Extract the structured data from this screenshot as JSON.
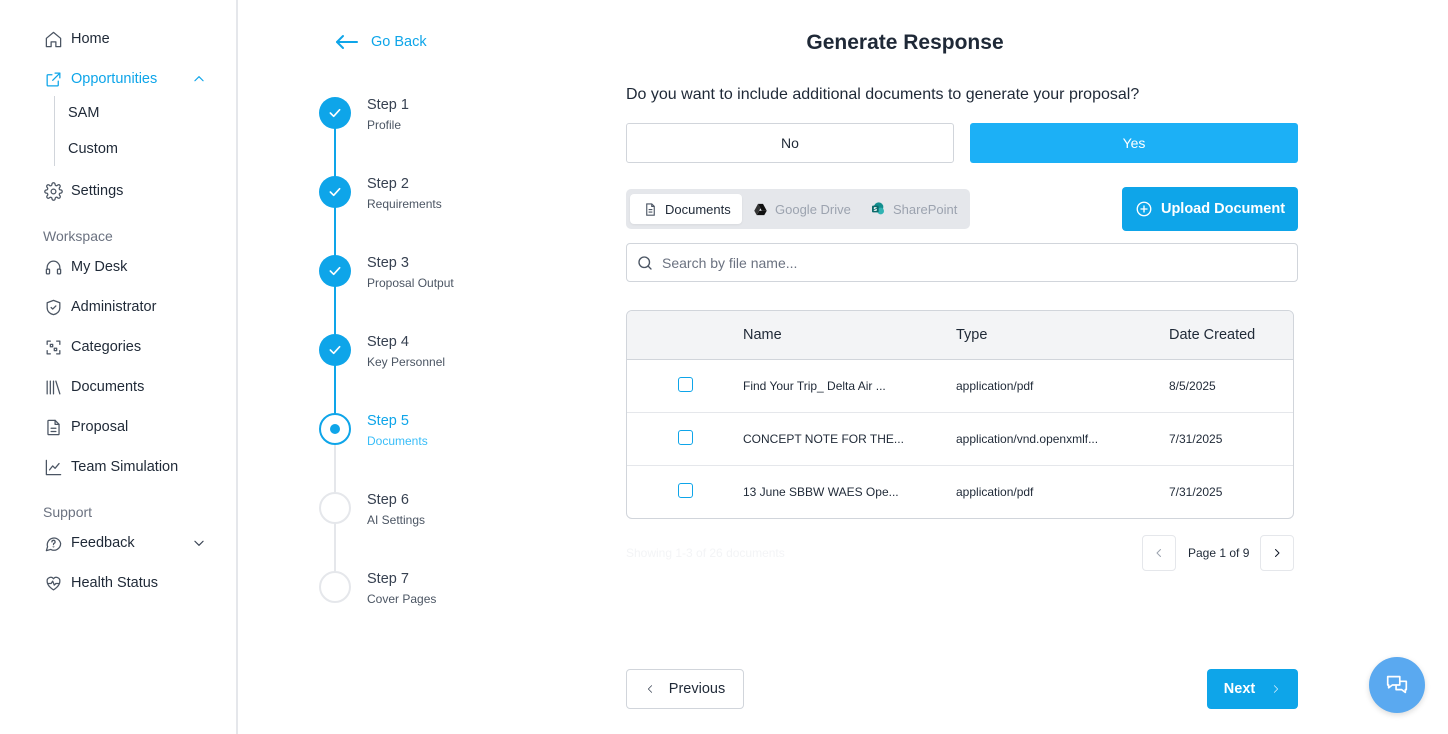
{
  "sidebar": {
    "items": [
      {
        "label": "Home",
        "icon": "home-icon"
      },
      {
        "label": "Opportunities",
        "icon": "external-link-icon",
        "active": true
      },
      {
        "label": "Settings",
        "icon": "gear-icon"
      }
    ],
    "opportunities_sub": [
      "SAM",
      "Custom"
    ],
    "workspace_label": "Workspace",
    "workspace_items": [
      {
        "label": "My Desk",
        "icon": "headset-icon"
      },
      {
        "label": "Administrator",
        "icon": "shield-icon"
      },
      {
        "label": "Categories",
        "icon": "categories-icon"
      },
      {
        "label": "Documents",
        "icon": "library-icon"
      },
      {
        "label": "Proposal",
        "icon": "file-text-icon"
      },
      {
        "label": "Team Simulation",
        "icon": "line-chart-icon"
      }
    ],
    "support_label": "Support",
    "support_items": [
      {
        "label": "Feedback",
        "icon": "message-circle-icon"
      },
      {
        "label": "Health Status",
        "icon": "heart-pulse-icon"
      }
    ]
  },
  "go_back": "Go Back",
  "steps": [
    {
      "title": "Step 1",
      "subtitle": "Profile",
      "status": "done"
    },
    {
      "title": "Step 2",
      "subtitle": "Requirements",
      "status": "done"
    },
    {
      "title": "Step 3",
      "subtitle": "Proposal Output",
      "status": "done"
    },
    {
      "title": "Step 4",
      "subtitle": "Key Personnel",
      "status": "done"
    },
    {
      "title": "Step 5",
      "subtitle": "Documents",
      "status": "current"
    },
    {
      "title": "Step 6",
      "subtitle": "AI Settings",
      "status": "todo"
    },
    {
      "title": "Step 7",
      "subtitle": "Cover Pages",
      "status": "todo"
    }
  ],
  "main": {
    "title": "Generate Response",
    "question": "Do you want to include additional documents to generate your proposal?",
    "no_label": "No",
    "yes_label": "Yes",
    "source_tabs": [
      {
        "label": "Documents",
        "icon": "document-icon",
        "active": true
      },
      {
        "label": "Google Drive",
        "icon": "google-drive-icon"
      },
      {
        "label": "SharePoint",
        "icon": "sharepoint-icon"
      }
    ],
    "upload_label": "Upload Document",
    "search_placeholder": "Search by file name...",
    "table": {
      "headers": [
        "Name",
        "Type",
        "Date Created"
      ],
      "rows": [
        {
          "name": "Find Your Trip_ Delta Air ...",
          "type": "application/pdf",
          "date": "8/5/2025"
        },
        {
          "name": "CONCEPT NOTE FOR THE...",
          "type": "application/vnd.openxmlf...",
          "date": "7/31/2025"
        },
        {
          "name": "13 June SBBW WAES Ope...",
          "type": "application/pdf",
          "date": "7/31/2025"
        }
      ]
    },
    "showing_text": "Showing 1-3 of 26 documents",
    "page_text": "Page 1 of 9",
    "previous_label": "Previous",
    "next_label": "Next"
  },
  "colors": {
    "accent": "#0ea5e9",
    "yes_button": "#1cb0f6",
    "chat_fab": "#5aa9f0"
  }
}
